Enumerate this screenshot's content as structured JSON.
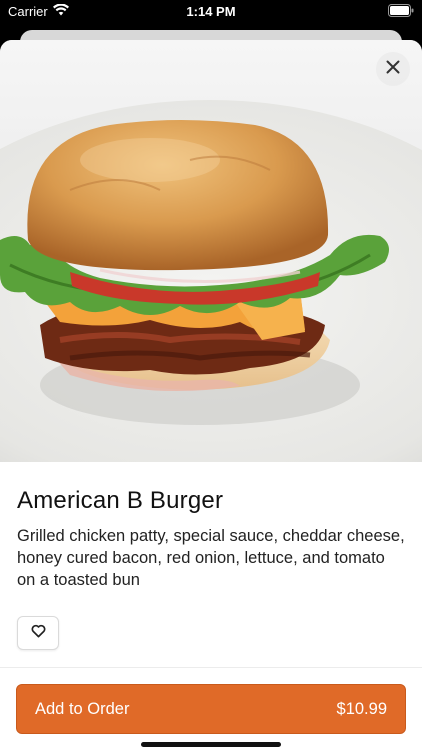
{
  "status_bar": {
    "carrier": "Carrier",
    "time": "1:14 PM",
    "wifi_icon": "wifi-icon",
    "battery_icon": "battery-icon"
  },
  "product": {
    "name": "American B Burger",
    "description": "Grilled chicken patty, special sauce, cheddar cheese, honey cured bacon, red onion, lettuce, and tomato on a toasted bun",
    "image_alt": "burger-photo"
  },
  "actions": {
    "close_icon": "close-icon",
    "favorite_icon": "heart-icon",
    "add_label": "Add to Order",
    "price": "$10.99"
  },
  "colors": {
    "accent": "#e06a28",
    "text": "#111111"
  }
}
